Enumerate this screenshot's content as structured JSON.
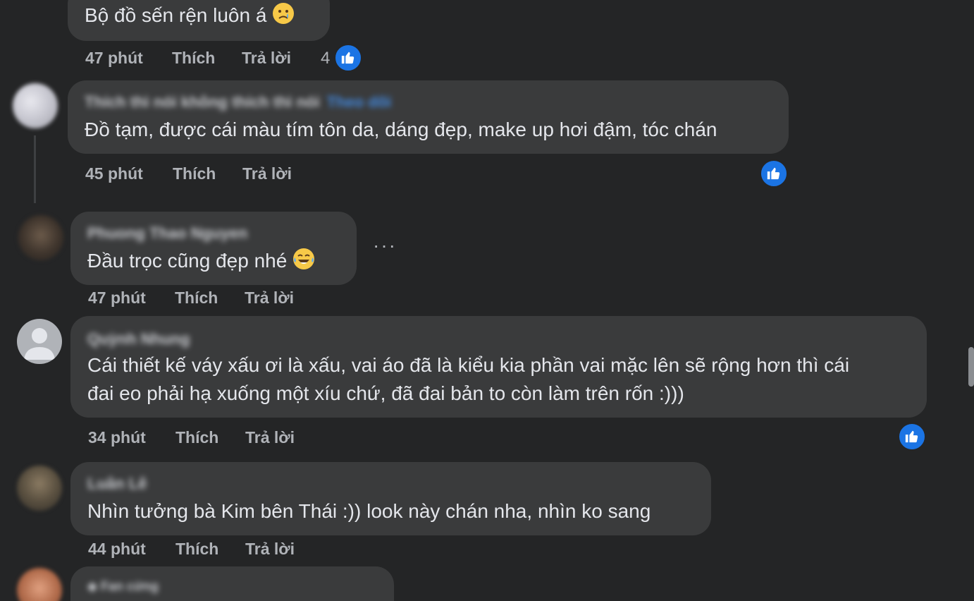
{
  "comments": [
    {
      "author": "",
      "text": "Bộ đồ sến rện luôn á",
      "emoji": "sad-tear-emoji",
      "time": "47 phút",
      "like": "Thích",
      "reply": "Trả lời",
      "reactions": "4"
    },
    {
      "author": "Thích thì nói không thích thì nói",
      "follow": "Theo dõi",
      "text": "Đồ tạm, được cái màu tím tôn da, dáng đẹp, make up hơi đậm, tóc chán",
      "time": "45 phút",
      "like": "Thích",
      "reply": "Trả lời"
    },
    {
      "author": "Phuong Thao Nguyen",
      "text": "Đầu trọc cũng đẹp nhé",
      "emoji": "laughing-tears-emoji",
      "more": "···",
      "time": "47 phút",
      "like": "Thích",
      "reply": "Trả lời"
    },
    {
      "author": "Quỳnh Nhung",
      "text_line1": "Cái thiết kế váy xấu ơi là xấu, vai áo đã là kiểu kia phần vai mặc lên sẽ rộng hơn thì cái",
      "text_line2": "đai eo phải hạ xuống một xíu chứ, đã đai bản to còn làm trên rốn :)))",
      "time": "34 phút",
      "like": "Thích",
      "reply": "Trả lời"
    },
    {
      "author": "Luân Lê",
      "text": "Nhìn tưởng bà Kim bên Thái :)) look này chán nha, nhìn ko sang",
      "time": "44 phút",
      "like": "Thích",
      "reply": "Trả lời"
    },
    {
      "author": "Fan cứng"
    }
  ],
  "colors": {
    "background": "#242526",
    "bubble": "#3a3b3c",
    "text": "#e4e6eb",
    "meta": "#b0b3b8",
    "like_blue": "#1b74e4"
  }
}
